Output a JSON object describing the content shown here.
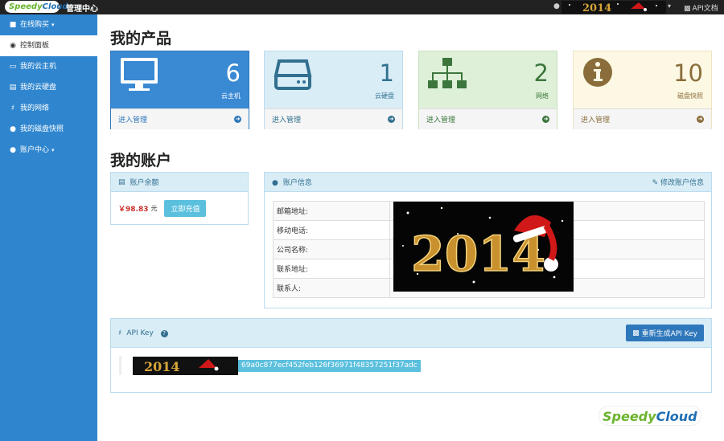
{
  "topbar": {
    "logo_part1": "Speedy",
    "logo_part2": "Cloud",
    "app_name": "管理中心",
    "api_doc": "API文档"
  },
  "sidebar": {
    "items": [
      {
        "label": "在线购买",
        "icon": "cart-icon",
        "active": false,
        "has_caret": true
      },
      {
        "label": "控制面板",
        "icon": "dashboard-icon",
        "active": true
      },
      {
        "label": "我的云主机",
        "icon": "desktop-icon",
        "active": false
      },
      {
        "label": "我的云硬盘",
        "icon": "disk-icon",
        "active": false
      },
      {
        "label": "我的网络",
        "icon": "network-icon",
        "active": false
      },
      {
        "label": "我的磁盘快照",
        "icon": "info-icon",
        "active": false
      },
      {
        "label": "账户中心",
        "icon": "user-icon",
        "active": false,
        "has_caret": true
      }
    ]
  },
  "products": {
    "title": "我的产品",
    "cards": [
      {
        "count": "6",
        "label": "云主机",
        "link": "进入管理",
        "icon": "desktop-icon",
        "color": "#3a89d3"
      },
      {
        "count": "1",
        "label": "云硬盘",
        "link": "进入管理",
        "icon": "disk-icon",
        "color": "#d9edf7"
      },
      {
        "count": "2",
        "label": "网络",
        "link": "进入管理",
        "icon": "network-icon",
        "color": "#dff0d8"
      },
      {
        "count": "10",
        "label": "磁盘快照",
        "link": "进入管理",
        "icon": "info-icon",
        "color": "#fcf8e3"
      }
    ]
  },
  "account": {
    "title": "我的账户",
    "balance_panel": {
      "heading": "账户余额",
      "amount": "￥98.83",
      "unit": "元",
      "recharge_button": "立即充值"
    },
    "info_panel": {
      "heading": "账户信息",
      "edit_link": "修改账户信息",
      "rows": [
        {
          "key": "邮箱地址:",
          "value": ""
        },
        {
          "key": "移动电话:",
          "value": ""
        },
        {
          "key": "公司名称:",
          "value": ""
        },
        {
          "key": "联系地址:",
          "value": ""
        },
        {
          "key": "联系人:",
          "value": ""
        }
      ],
      "overlay_image_text": "2014"
    }
  },
  "apikey": {
    "heading": "API Key",
    "regen_button": "重新生成API Key",
    "key_suffix": "69a0c877ecf452feb126f36971f48357251f37adc"
  },
  "colors": {
    "sidebar_bg": "#2f86cf",
    "topbar_bg": "#222222",
    "accent_blue": "#2e77bb",
    "info_bg": "#d9edf7",
    "price_red": "#c9302c"
  }
}
